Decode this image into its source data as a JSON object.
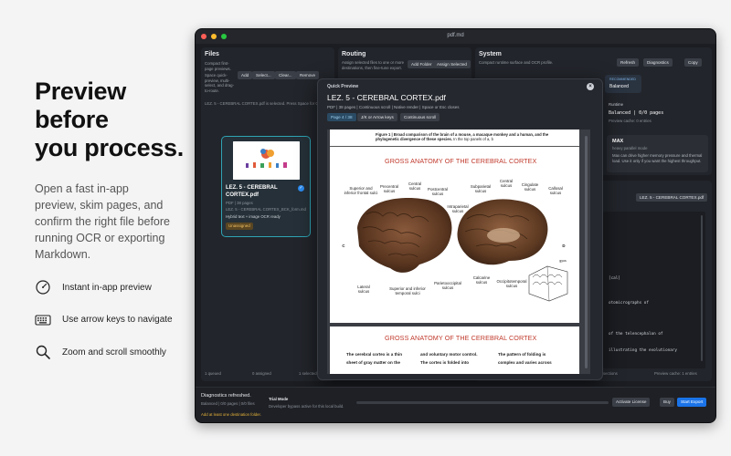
{
  "hero": {
    "title_line1": "Preview",
    "title_line2": "before",
    "title_line3": "you process.",
    "lede": "Open a fast in-app preview, skim pages, and confirm the right file before running OCR or exporting Markdown."
  },
  "features": [
    {
      "icon": "gauge-icon",
      "label": "Instant in-app preview"
    },
    {
      "icon": "keyboard-icon",
      "label": "Use arrow keys to navigate"
    },
    {
      "icon": "magnifier-icon",
      "label": "Zoom and scroll smoothly"
    }
  ],
  "window": {
    "title": "pdf.md",
    "files": {
      "title": "Files",
      "subtitle": "Compact first-page previews.",
      "hint": "Space quick-preview, multi-select, and drag-to-route.",
      "buttons": [
        "Add",
        "Select...",
        "Clear...",
        "Remove"
      ],
      "selected_note": "LEZ. 5 - CEREBRAL CORTEX.pdf is selected. Press Space for Quick Preview.",
      "card": {
        "name": "LEZ. 5 - CEREBRAL CORTEX.pdf",
        "meta1": "PDF | 38 pages",
        "meta2": "LEZ. 5 - CEREBRAL CORTEX_BCK_form.md",
        "detail": "Hybrid text + image OCR ready",
        "status": "Unassigned"
      },
      "footer": [
        "1 queued",
        "0 assigned",
        "1 selected"
      ]
    },
    "routing": {
      "title": "Routing",
      "subtitle": "Assign selected files to one or more destinations, then fine-tune export.",
      "buttons": [
        "Add Folder",
        "Assign Selected"
      ]
    },
    "system": {
      "title": "System",
      "subtitle": "Compact runtime surface and OCR profile.",
      "buttons": [
        "Refresh",
        "Diagnostics",
        "Copy"
      ],
      "recommended_label": "RECOMMENDED",
      "recommended_value": "Balanced",
      "runtime_label": "Runtime",
      "runtime_value": "Balanced | 0/0 pages",
      "runtime_sub": "Preview cache: 0 entries",
      "max_title": "MAX",
      "max_sub": "heavy parallel mode",
      "max_desc": "Max can drive higher memory pressure and thermal load. Use it only if you want the highest throughput.",
      "sections_title": "Selected file",
      "sections_chip": "LEZ. 5 - CEREBRAL CORTEX.pdf",
      "code_lines": [
        "[cal]",
        "otomicrographs of",
        "of the telencephalon of",
        "illustrating the evolutionary"
      ],
      "footer_left": "sections",
      "footer_right": "Preview cache: 1 entries"
    },
    "modal": {
      "header": "Quick Preview",
      "close": "×",
      "title": "LEZ. 5 - CEREBRAL CORTEX.pdf",
      "meta": "PDF | 38 pages | Continuous scroll | Native render | Space or Esc closes",
      "chips": [
        "Page 4 / 38",
        "J/K or Arrow keys",
        "Continuous scroll"
      ],
      "page1": {
        "caption_bold": "Figure 1 | Broad comparison of the brain of a mouse, a macaque monkey and a human, and the phylogenetic divergence of these species.",
        "caption_rest": " In the top panels of a, b",
        "heading": "GROSS ANATOMY OF THE CEREBRAL CORTEX",
        "labels": [
          "Superior and inferior frontal sulci",
          "Precentral sulcus",
          "Central sulcus",
          "Postcentral sulcus",
          "Intraparietal sulcus",
          "Subparietal sulcus",
          "Central sulcus",
          "Cingulate sulcus",
          "Callosal sulcus",
          "Lateral sulcus",
          "Superior and inferior temporal sulci",
          "Parietooccipital sulcus",
          "Calcarine sulcus",
          "Occipitotemporal sulcus",
          "C",
          "D",
          "gyus"
        ]
      },
      "page2": {
        "heading": "GROSS ANATOMY OF THE CEREBRAL CORTEX",
        "col1": [
          "The cerebral cortex is a thin",
          "sheet of gray matter on the"
        ],
        "col2": [
          "and voluntary motor control.",
          "The cortex is folded into"
        ],
        "col3": [
          "The pattern of folding is",
          "complex and varies across"
        ]
      }
    },
    "bottom": {
      "status": "Diagnostics refreshed.",
      "status_sub": "Balanced | 0/0 pages | 0/0 files",
      "warning": "Add at least one destination folder.",
      "trial_title": "Trial Mode",
      "trial_sub": "Developer bypass active for this local build.",
      "progress": 0,
      "buttons": [
        "Activate License",
        "Buy",
        "Start Export"
      ]
    },
    "colors": {
      "accent": "#1a73e8",
      "card_border": "#2fa3b4",
      "warning": "#e6b23a",
      "red_heading": "#c0392b"
    }
  }
}
